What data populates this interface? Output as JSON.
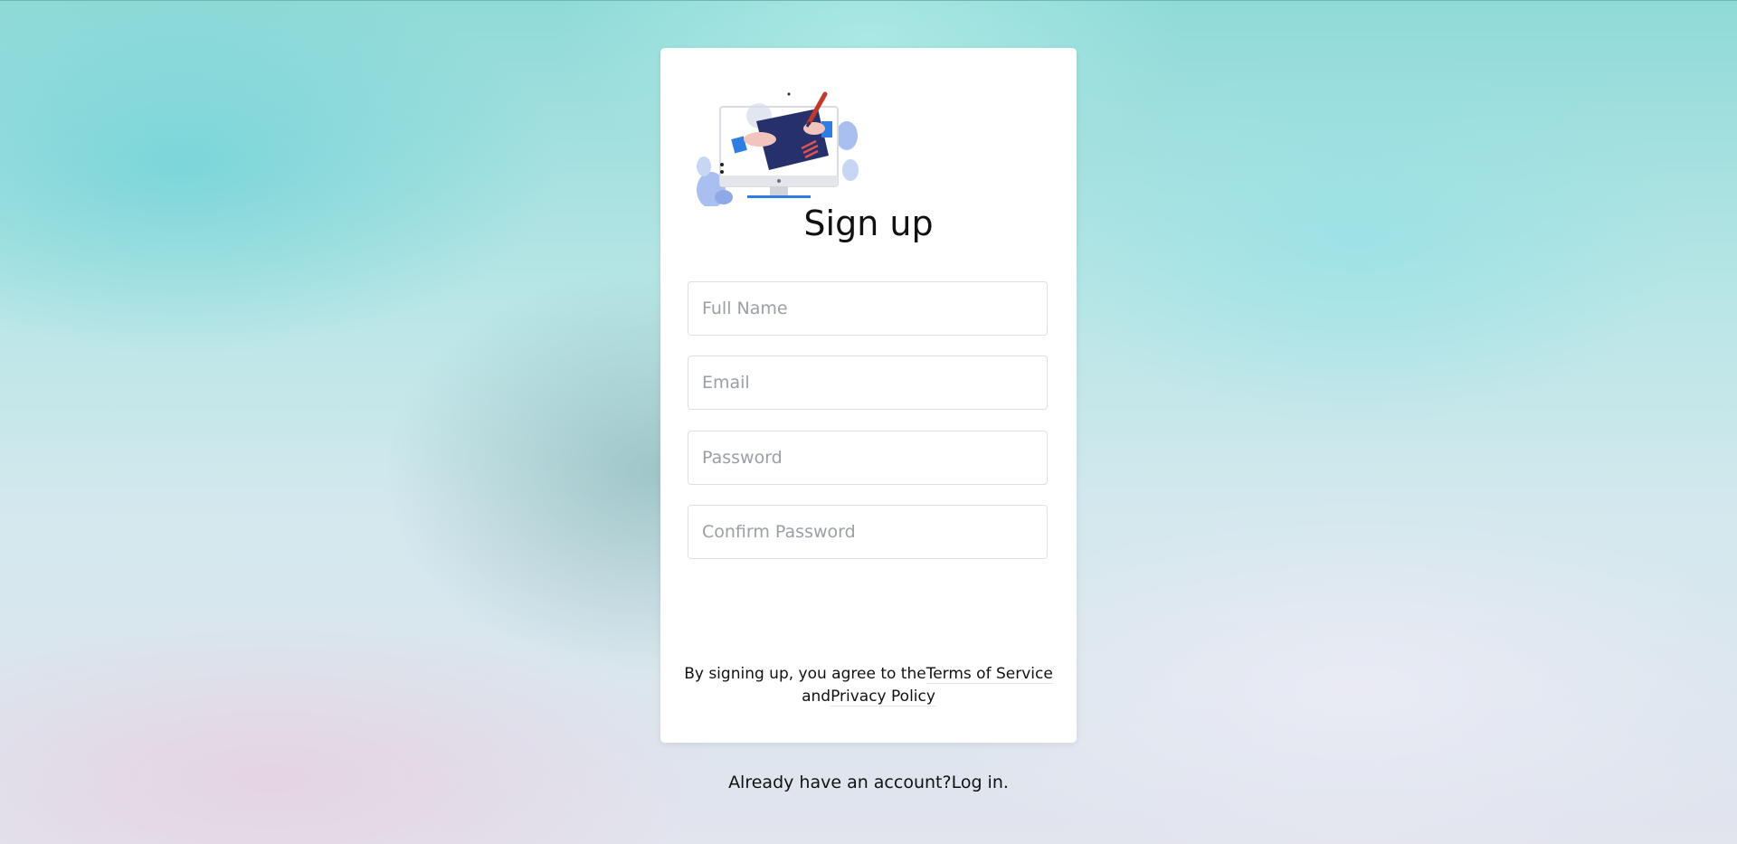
{
  "page": {
    "background_color": "#b8e6e6"
  },
  "card": {
    "illustration_icon": "signup-illustration",
    "title": "Sign up"
  },
  "form": {
    "full_name": {
      "value": "",
      "placeholder": "Full Name"
    },
    "email": {
      "value": "",
      "placeholder": "Email"
    },
    "password": {
      "value": "",
      "placeholder": "Password"
    },
    "confirm_password": {
      "value": "",
      "placeholder": "Confirm Password"
    }
  },
  "legal": {
    "prefix": "By signing up, you agree to the",
    "terms_link": "Terms of Service",
    "and": "and",
    "privacy_link": "Privacy Policy"
  },
  "footer": {
    "prompt": "Already have an account?",
    "login_link": "Log in."
  }
}
